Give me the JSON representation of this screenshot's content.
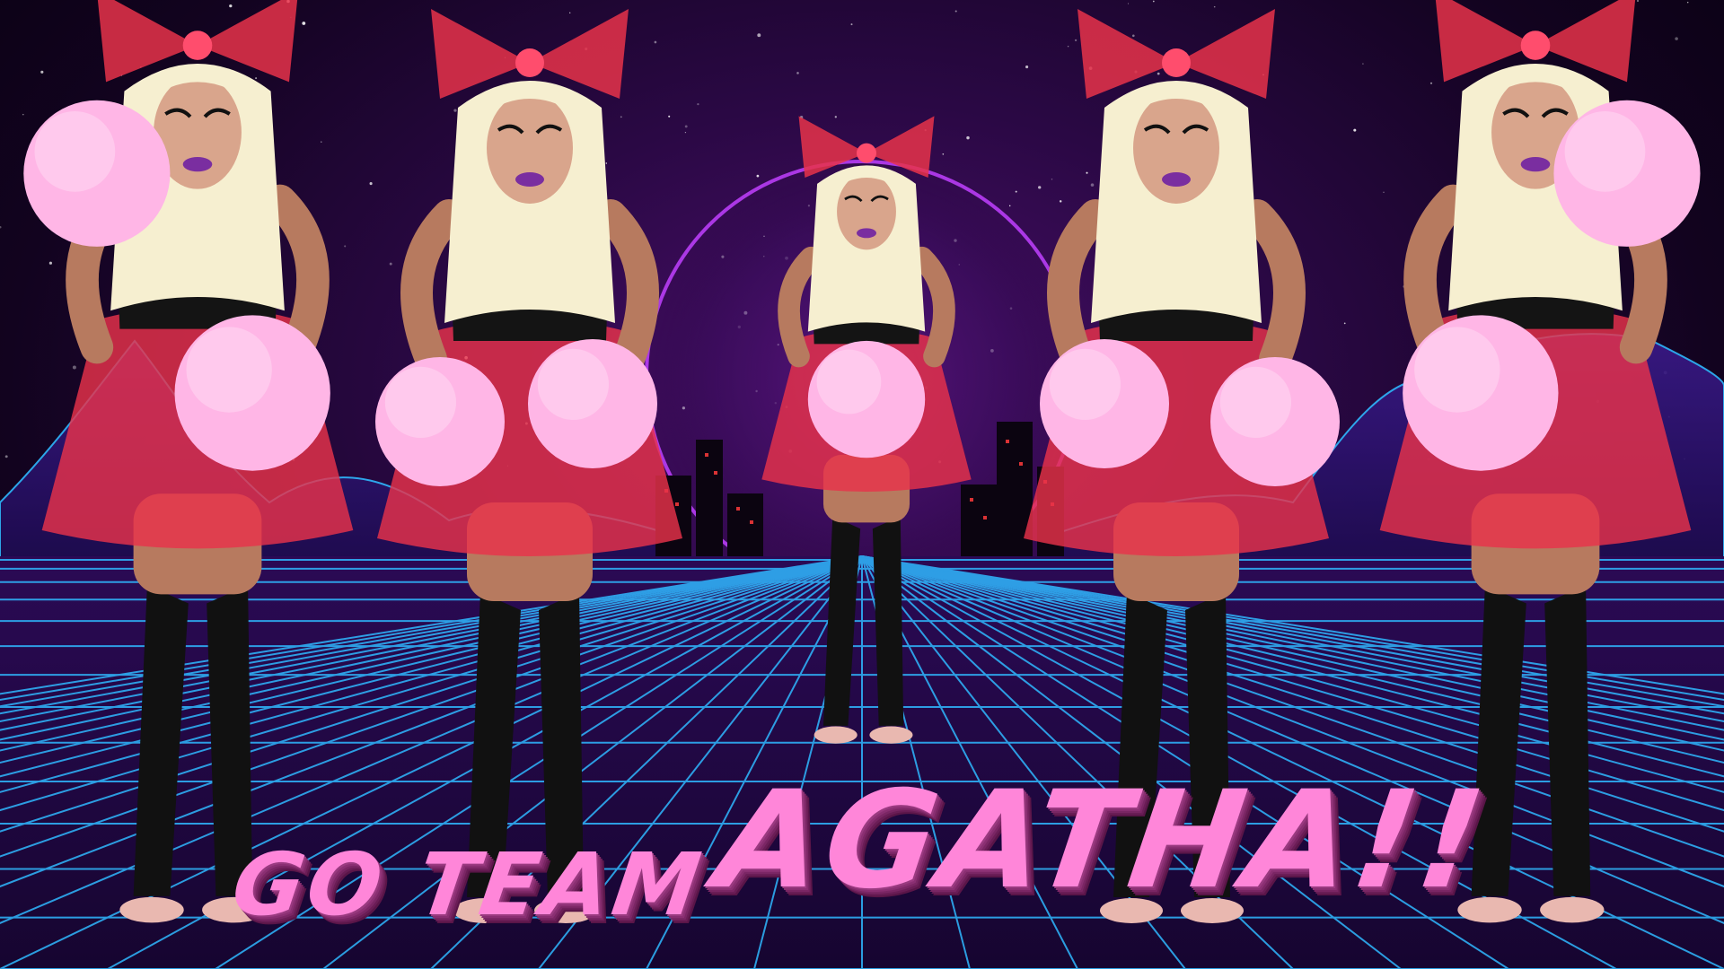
{
  "caption": {
    "line_small": "Go team",
    "line_large": "AGATHA!!"
  },
  "colors": {
    "caption_fill": "#ff86d9",
    "caption_extrude": "#7a2664",
    "grid_line": "#2fb8ff",
    "sky_purple": "#4a0f6b",
    "sun_ring": "#c040ff",
    "city_windows": "#ff3b3b",
    "bow_red": "#e8324a",
    "pompom_pink": "#ffb6e6",
    "wig_blonde": "#f6efd0"
  },
  "scene": {
    "background": "retro synthwave neon grid with wireframe mountains and city skyline",
    "performer_count": 5
  }
}
